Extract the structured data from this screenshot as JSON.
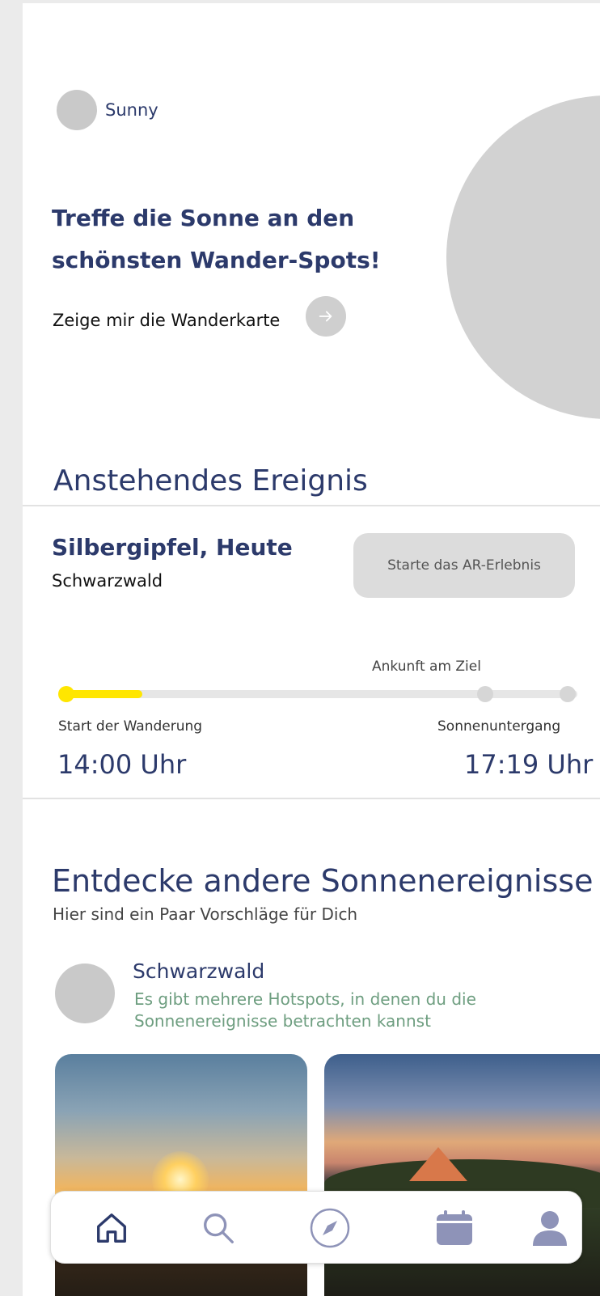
{
  "brand": {
    "name": "Sunny"
  },
  "hero": {
    "headline": "Treffe die Sonne an den schönsten Wander-Spots!",
    "map_link": "Zeige mir die Wanderkarte"
  },
  "upcoming": {
    "section_title": "Anstehendes Ereignis",
    "event_title": "Silbergipfel, Heute",
    "event_region": "Schwarzwald",
    "ar_button": "Starte das AR-Erlebnis",
    "timeline": {
      "progress": 0.16,
      "arrival_label": "Ankunft am Ziel",
      "start_label": "Start der Wanderung",
      "sunset_label": "Sonnenuntergang",
      "start_time": "14:00 Uhr",
      "sunset_time": "17:19 Uhr"
    }
  },
  "discover": {
    "title": "Entdecke andere Sonnenereignisse",
    "subtitle": "Hier sind ein Paar Vorschläge für Dich",
    "location": {
      "name": "Schwarzwald",
      "description": "Es gibt mehrere Hotspots, in denen du die Sonnenereignisse betrachten kannst"
    }
  },
  "nav": {
    "items": [
      {
        "icon": "home-icon",
        "active": true
      },
      {
        "icon": "search-icon",
        "active": false
      },
      {
        "icon": "compass-icon",
        "active": false
      },
      {
        "icon": "calendar-icon",
        "active": false
      },
      {
        "icon": "profile-icon",
        "active": false
      }
    ]
  },
  "colors": {
    "navy": "#2c3a6b",
    "accent_yellow": "#ffe600",
    "green_text": "#6e9e80",
    "nav_icon": "#8e93b8"
  }
}
